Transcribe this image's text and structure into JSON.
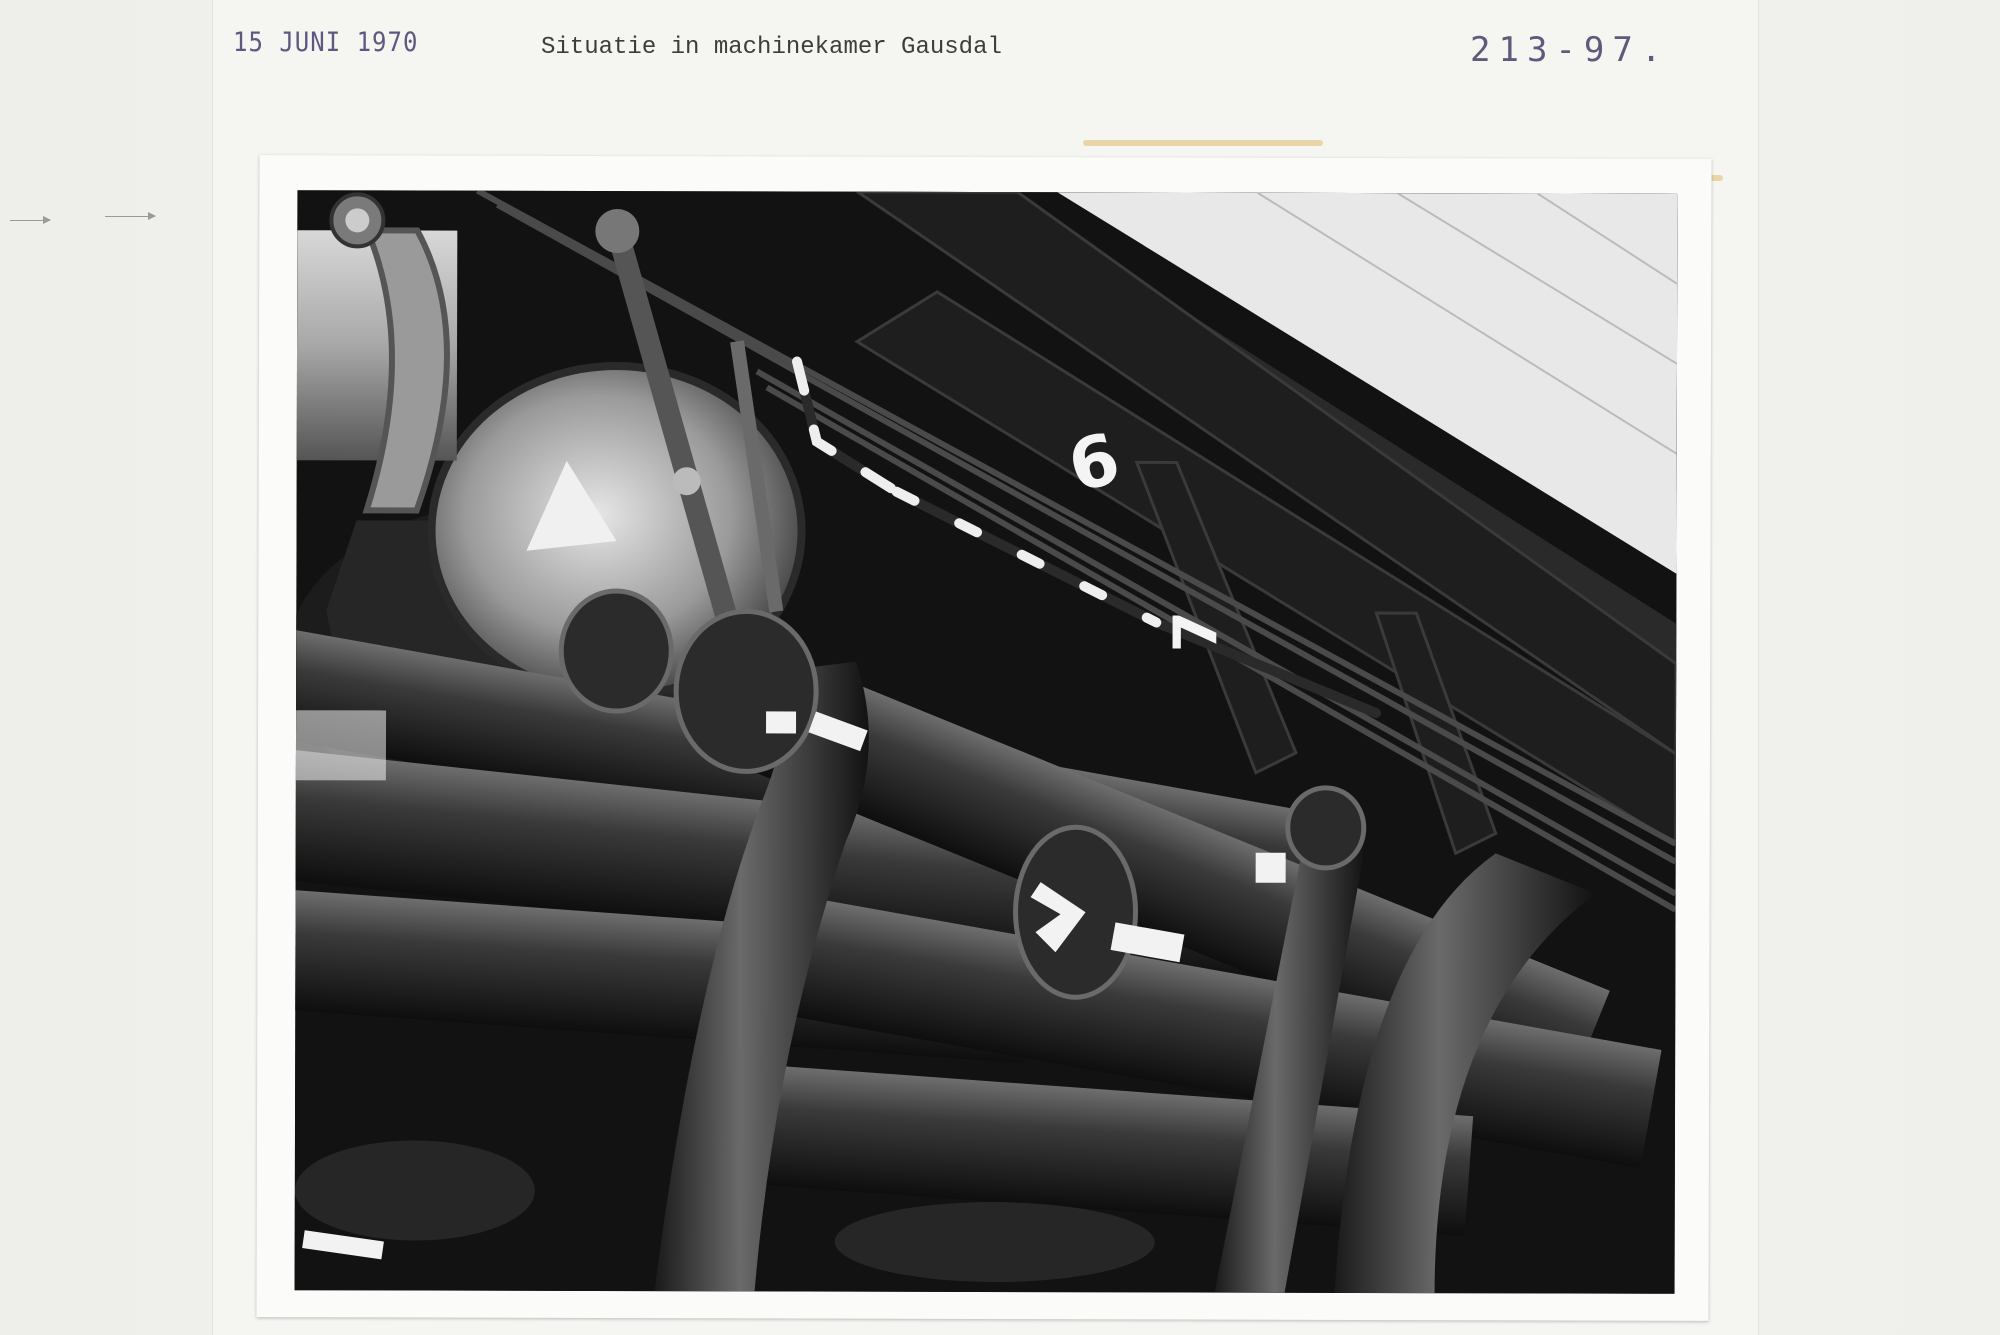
{
  "card": {
    "stamp_date": "15 JUNI 1970",
    "caption": "Situatie in machinekamer Gausdal",
    "archive_number": "213-97."
  },
  "photo": {
    "markings": [
      "6",
      "7"
    ]
  },
  "colors": {
    "stamp_ink": "#5e5880",
    "typewriter_ink": "#3d3d3d",
    "card": "#f5f5f2"
  }
}
